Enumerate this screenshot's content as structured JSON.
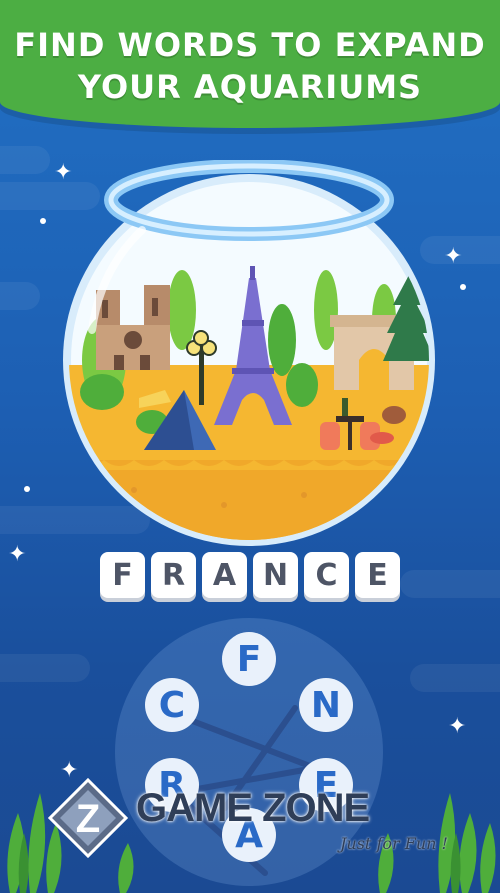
{
  "banner": {
    "line1": "FIND WORDS TO EXPAND",
    "line2": "YOUR AQUARIUMS",
    "color": "#4cae43"
  },
  "answer": {
    "letters": [
      "F",
      "R",
      "A",
      "N",
      "C",
      "E"
    ]
  },
  "wheel": {
    "letters": [
      "F",
      "N",
      "E",
      "A",
      "R",
      "C"
    ]
  },
  "watermark": {
    "brand": "GAME ZONE",
    "tagline": "Just for Fun !",
    "logo_letter": "Z"
  },
  "colors": {
    "background": "#1d5fb3",
    "tile": "#ffffff",
    "letter_circle": "#e9f1fb",
    "letter_text": "#2a6ac7"
  }
}
